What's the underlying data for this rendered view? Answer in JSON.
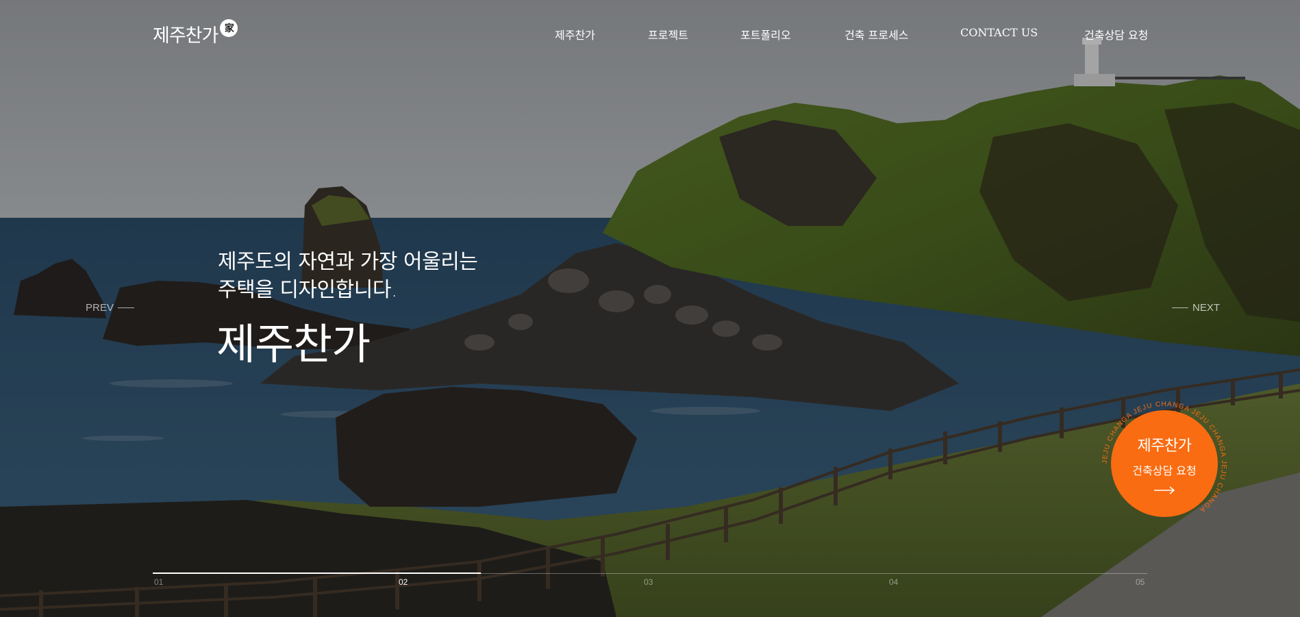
{
  "brand": {
    "logo_text": "제주찬가",
    "logo_mark": "家"
  },
  "nav": {
    "items": [
      "제주찬가",
      "프로젝트",
      "포트폴리오",
      "건축 프로세스",
      "CONTACT US",
      "건축상담 요청"
    ]
  },
  "hero": {
    "tagline_line1": "제주도의 자연과 가장 어울리는",
    "tagline_line2": "주택을 디자인합니다.",
    "title": "제주찬가"
  },
  "slider": {
    "prev_label": "PREV",
    "next_label": "NEXT",
    "steps": [
      "01",
      "02",
      "03",
      "04",
      "05"
    ],
    "active_index": 1,
    "progress": 0.33
  },
  "cta": {
    "title": "제주찬가",
    "subtitle": "건축상담 요청",
    "ring_text": "JEJU CHANGA JEJU CHANGA JEJU CHANGA JEJU CHANGA ",
    "arrow_icon": "arrow-right-icon",
    "color": "#f96c12"
  }
}
